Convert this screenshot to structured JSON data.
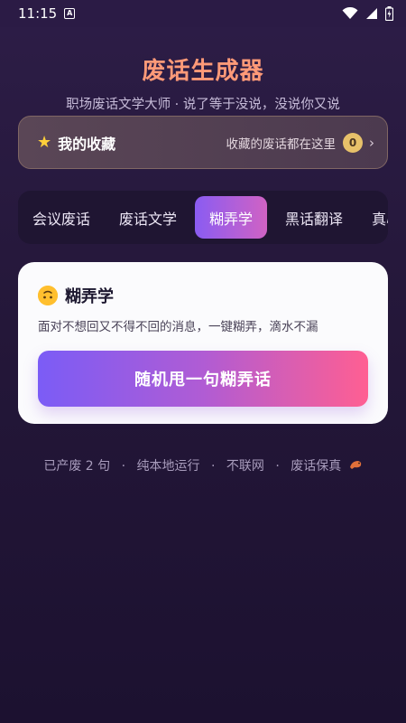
{
  "statusbar": {
    "time": "11:15",
    "icons": [
      "notification-a-icon",
      "wifi-icon",
      "cell-signal-icon",
      "battery-icon"
    ]
  },
  "header": {
    "title": "废话生成器",
    "subtitle": "职场废话文学大师 · 说了等于没说，没说你又说"
  },
  "favorites": {
    "title": "我的收藏",
    "description": "收藏的废话都在这里",
    "count": "0",
    "chevron": "›"
  },
  "tabs": [
    {
      "label": "会议废话",
      "active": false
    },
    {
      "label": "废话文学",
      "active": false
    },
    {
      "label": "糊弄学",
      "active": true
    },
    {
      "label": "黑话翻译",
      "active": false
    },
    {
      "label": "真心",
      "active": false
    }
  ],
  "card": {
    "title": "糊弄学",
    "description": "面对不想回又不得不回的消息，一键糊弄，滴水不漏",
    "button_label": "随机甩一句糊弄话"
  },
  "footer": {
    "count_text": "已产废 2 句",
    "item2": "纯本地运行",
    "item3": "不联网",
    "item4": "废话保真",
    "separator": "·"
  },
  "colors": {
    "accent_purple": "#8a5cf2",
    "accent_pink": "#ff5f92",
    "title_orange": "#ff9a78"
  }
}
